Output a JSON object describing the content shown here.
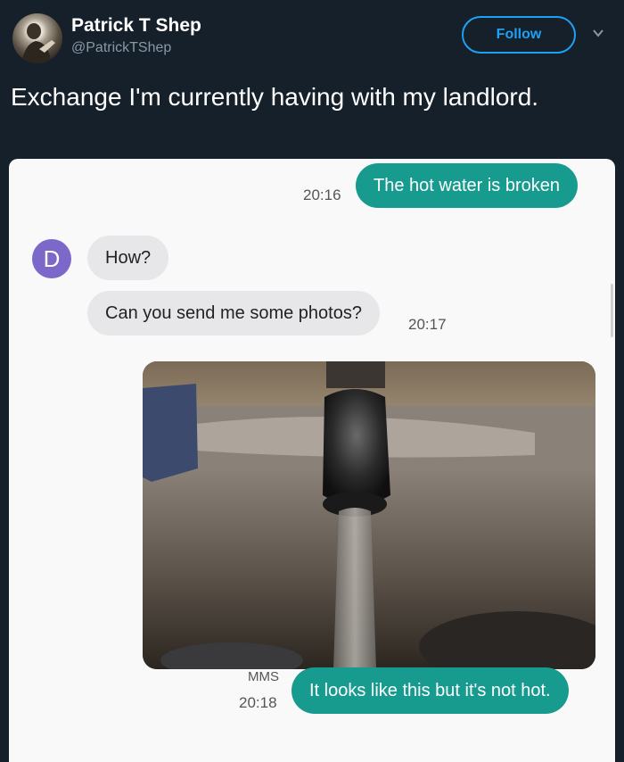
{
  "tweet": {
    "display_name": "Patrick T Shep",
    "handle": "@PatrickTShep",
    "follow_label": "Follow",
    "text": "Exchange I'm currently having with my landlord."
  },
  "conversation": {
    "contact_initial": "D",
    "messages": [
      {
        "direction": "out",
        "text": "The hot water is broken",
        "time": "20:16"
      },
      {
        "direction": "in",
        "text": "How?"
      },
      {
        "direction": "in",
        "text": "Can you send me some photos?",
        "time": "20:17"
      },
      {
        "direction": "out",
        "type": "image",
        "label": "MMS",
        "caption": "It looks like this but it's not hot.",
        "time": "20:18"
      }
    ]
  },
  "colors": {
    "background": "#15202b",
    "accent": "#1da1f2",
    "outgoing_bubble": "#189b8f",
    "incoming_bubble": "#e7e7e9",
    "contact_avatar": "#7b68c9"
  },
  "icons": [
    "chevron-down-icon"
  ]
}
